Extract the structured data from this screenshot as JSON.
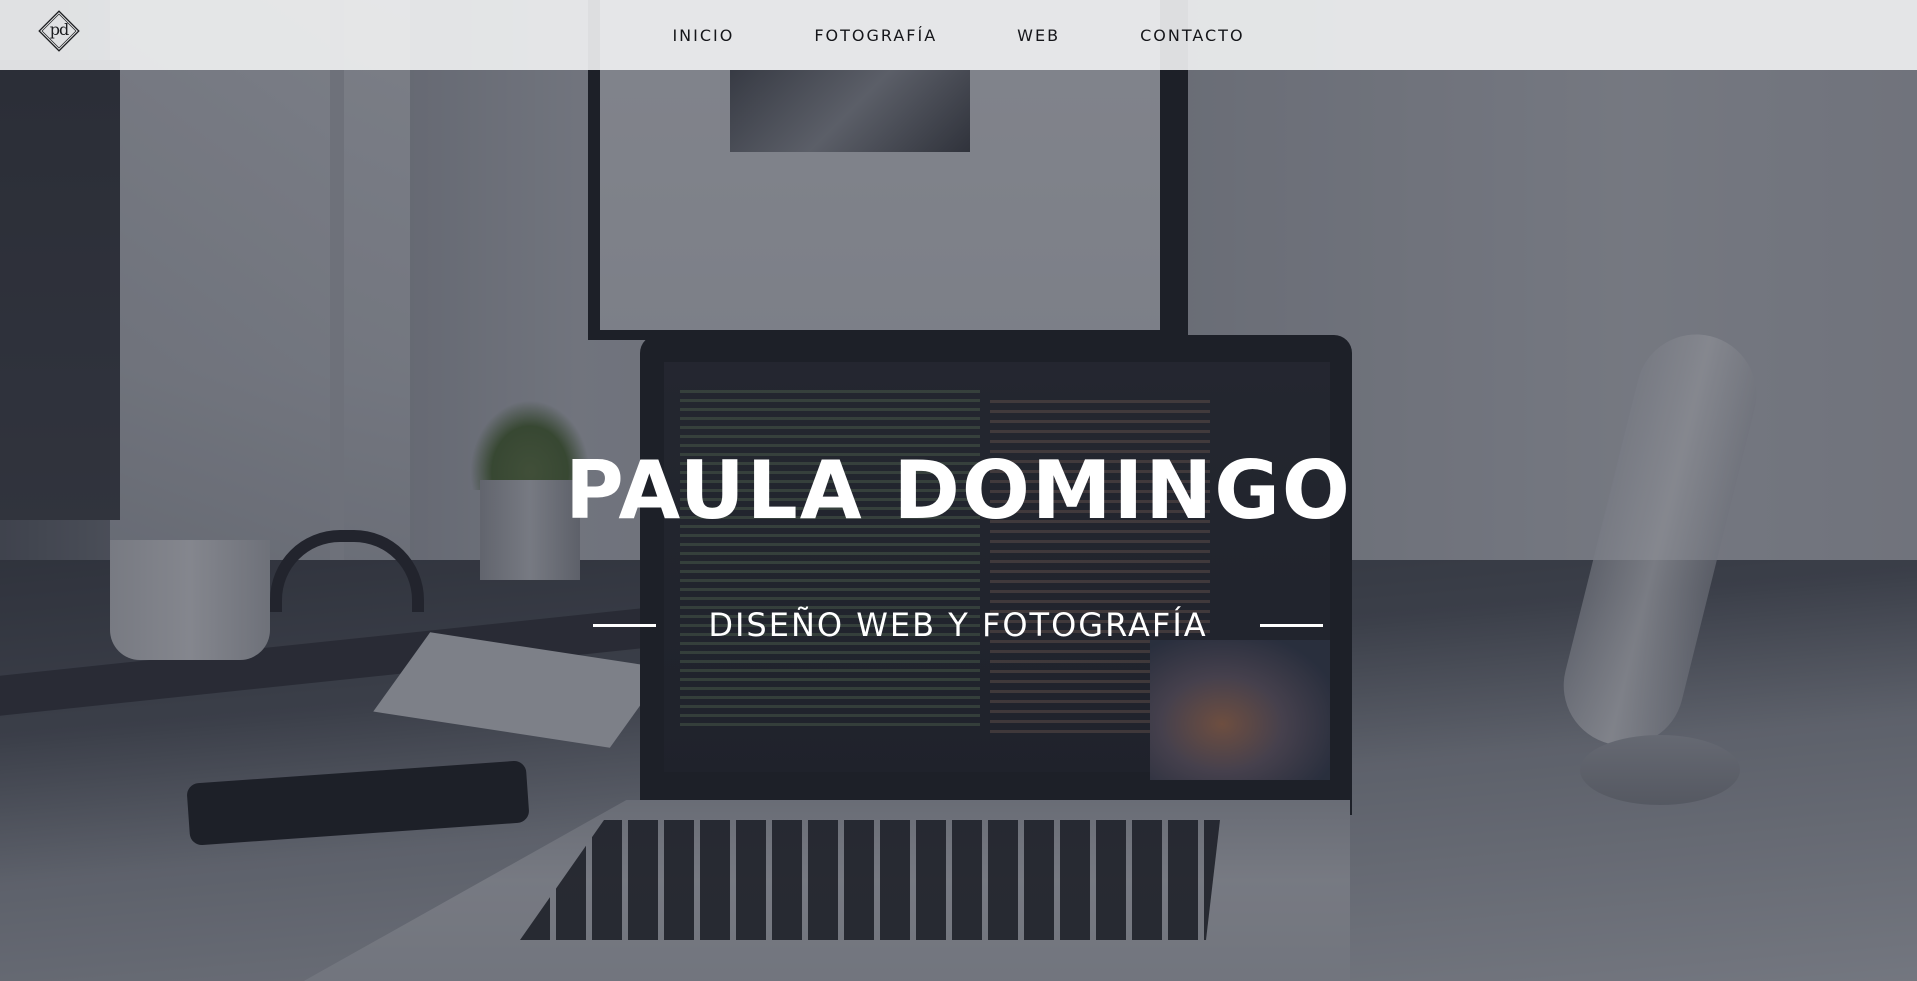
{
  "brand": {
    "logo_text": "pd",
    "logo_icon": "diamond-monogram-icon"
  },
  "nav": {
    "items": [
      {
        "label": "INICIO"
      },
      {
        "label": "FOTOGRAFÍA"
      },
      {
        "label": "WEB"
      },
      {
        "label": "CONTACTO"
      }
    ]
  },
  "hero": {
    "title": "PAULA DOMINGO",
    "subtitle": "DISEÑO WEB Y FOTOGRAFÍA",
    "background": "workspace-laptop-photo"
  },
  "colors": {
    "navbar_bg": "#eeeff0",
    "nav_text": "#15161a",
    "hero_text": "#ffffff",
    "overlay": "#282c38"
  }
}
